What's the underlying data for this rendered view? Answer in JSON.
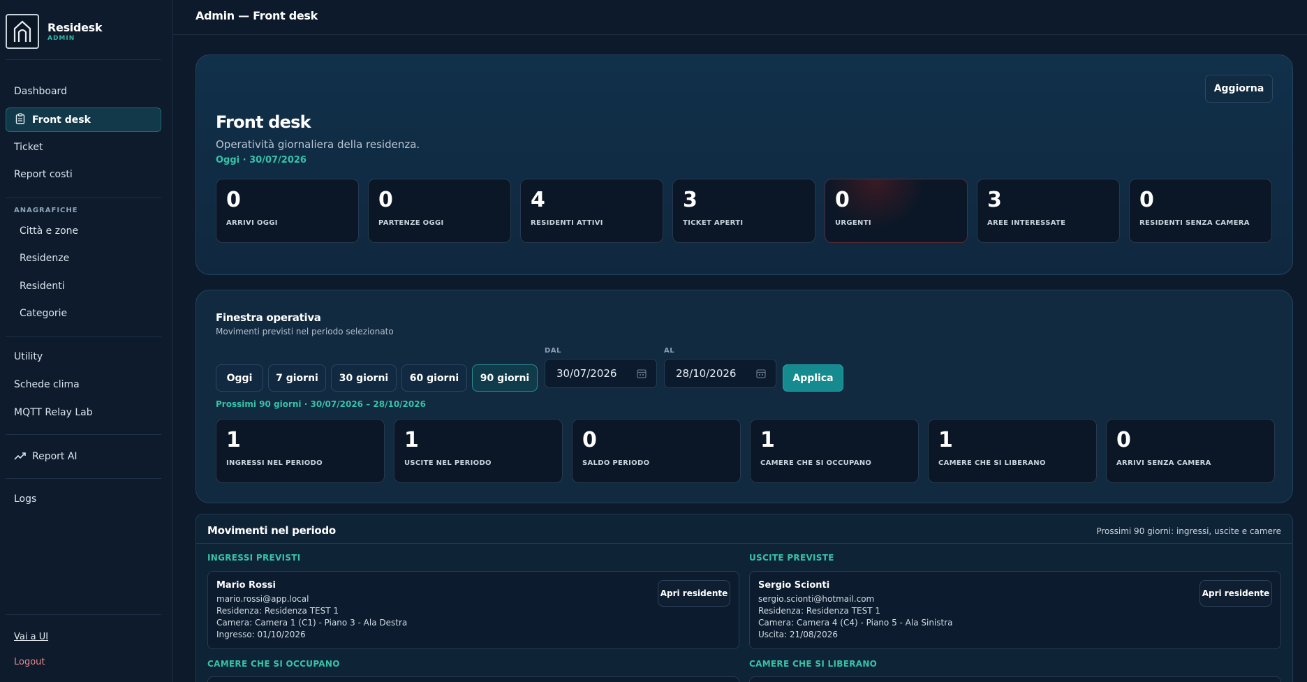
{
  "brand": {
    "name": "Residesk",
    "role": "ADMIN"
  },
  "sidebar": {
    "dashboard": "Dashboard",
    "front_desk": "Front desk",
    "ticket": "Ticket",
    "report_costi": "Report costi",
    "anagrafiche_label": "ANAGRAFICHE",
    "citta": "Città e zone",
    "residenze": "Residenze",
    "residenti": "Residenti",
    "categorie": "Categorie",
    "utility": "Utility",
    "schede_clima": "Schede clima",
    "mqtt": "MQTT Relay Lab",
    "report_ai": "Report AI",
    "logs": "Logs",
    "vai_ui": "Vai a UI",
    "logout": "Logout"
  },
  "topbar": {
    "title": "Admin — Front desk"
  },
  "hero": {
    "refresh": "Aggiorna",
    "title": "Front desk",
    "subtitle": "Operatività giornaliera della residenza.",
    "date": "Oggi · 30/07/2026",
    "stats": [
      {
        "value": "0",
        "label": "ARRIVI OGGI"
      },
      {
        "value": "0",
        "label": "PARTENZE OGGI"
      },
      {
        "value": "4",
        "label": "RESIDENTI ATTIVI"
      },
      {
        "value": "3",
        "label": "TICKET APERTI"
      },
      {
        "value": "0",
        "label": "URGENTI"
      },
      {
        "value": "3",
        "label": "AREE INTERESSATE"
      },
      {
        "value": "0",
        "label": "RESIDENTI SENZA CAMERA"
      }
    ]
  },
  "window": {
    "title": "Finestra operativa",
    "subtitle": "Movimenti previsti nel periodo selezionato",
    "chips": [
      "Oggi",
      "7 giorni",
      "30 giorni",
      "60 giorni",
      "90 giorni"
    ],
    "active_chip": "90 giorni",
    "from_label": "DAL",
    "from_value": "30/07/2026",
    "to_label": "AL",
    "to_value": "28/10/2026",
    "apply": "Applica",
    "period": "Prossimi 90 giorni · 30/07/2026 – 28/10/2026",
    "stats": [
      {
        "value": "1",
        "label": "INGRESSI NEL PERIODO"
      },
      {
        "value": "1",
        "label": "USCITE NEL PERIODO"
      },
      {
        "value": "0",
        "label": "SALDO PERIODO"
      },
      {
        "value": "1",
        "label": "CAMERE CHE SI OCCUPANO"
      },
      {
        "value": "1",
        "label": "CAMERE CHE SI LIBERANO"
      },
      {
        "value": "0",
        "label": "ARRIVI SENZA CAMERA"
      }
    ]
  },
  "movimenti": {
    "title": "Movimenti nel periodo",
    "right_note": "Prossimi 90 giorni: ingressi, uscite e camere",
    "ingressi_label": "INGRESSI PREVISTI",
    "uscite_label": "USCITE PREVISTE",
    "occupano_label": "CAMERE CHE SI OCCUPANO",
    "liberano_label": "CAMERE CHE SI LIBERANO",
    "open_btn": "Apri residente",
    "ingresso": {
      "name": "Mario Rossi",
      "email": "mario.rossi@app.local",
      "residenza": "Residenza: Residenza TEST 1",
      "camera": "Camera: Camera 1 (C1) - Piano 3 - Ala Destra",
      "date": "Ingresso: 01/10/2026"
    },
    "uscita": {
      "name": "Sergio Scionti",
      "email": "sergio.scionti@hotmail.com",
      "residenza": "Residenza: Residenza TEST 1",
      "camera": "Camera: Camera 4 (C4) - Piano 5 - Ala Sinistra",
      "date": "Uscita: 21/08/2026"
    }
  },
  "colors": {
    "accent": "#35c3a8",
    "apply": "#168b8f",
    "background": "#0c1a2b",
    "logout": "#e58a8a"
  }
}
